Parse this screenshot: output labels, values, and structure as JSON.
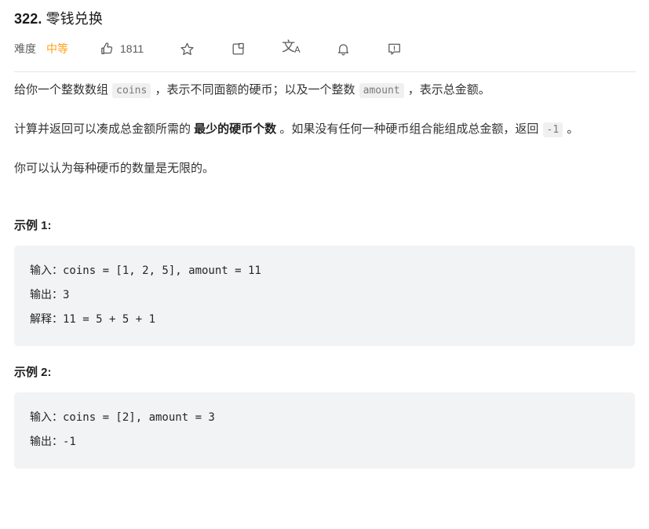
{
  "problem": {
    "number": "322.",
    "title": "零钱兑换",
    "difficulty_label": "难度",
    "difficulty_value": "中等",
    "difficulty_color": "#ffa116",
    "like_count": "1811"
  },
  "actions": {
    "like": "thumbs-up-icon",
    "favorite": "star-icon",
    "share": "share-icon",
    "translate_glyph": "文",
    "translate_sub": "A",
    "notify": "bell-icon",
    "report": "comment-report-icon"
  },
  "description": {
    "p1_part1": "给你一个整数数组 ",
    "p1_code1": "coins",
    "p1_part2": " ，表示不同面额的硬币；以及一个整数 ",
    "p1_code2": "amount",
    "p1_part3": " ，表示总金额。",
    "p2_part1": "计算并返回可以凑成总金额所需的 ",
    "p2_bold": "最少的硬币个数",
    "p2_part2": " 。如果没有任何一种硬币组合能组成总金额，返回 ",
    "p2_code": "-1",
    "p2_part3": " 。",
    "p3": "你可以认为每种硬币的数量是无限的。"
  },
  "examples": [
    {
      "heading": "示例 1:",
      "code": "输入：coins = [1, 2, 5], amount = 11\n输出：3\n解释：11 = 5 + 5 + 1"
    },
    {
      "heading": "示例 2:",
      "code": "输入：coins = [2], amount = 3\n输出：-1"
    }
  ]
}
